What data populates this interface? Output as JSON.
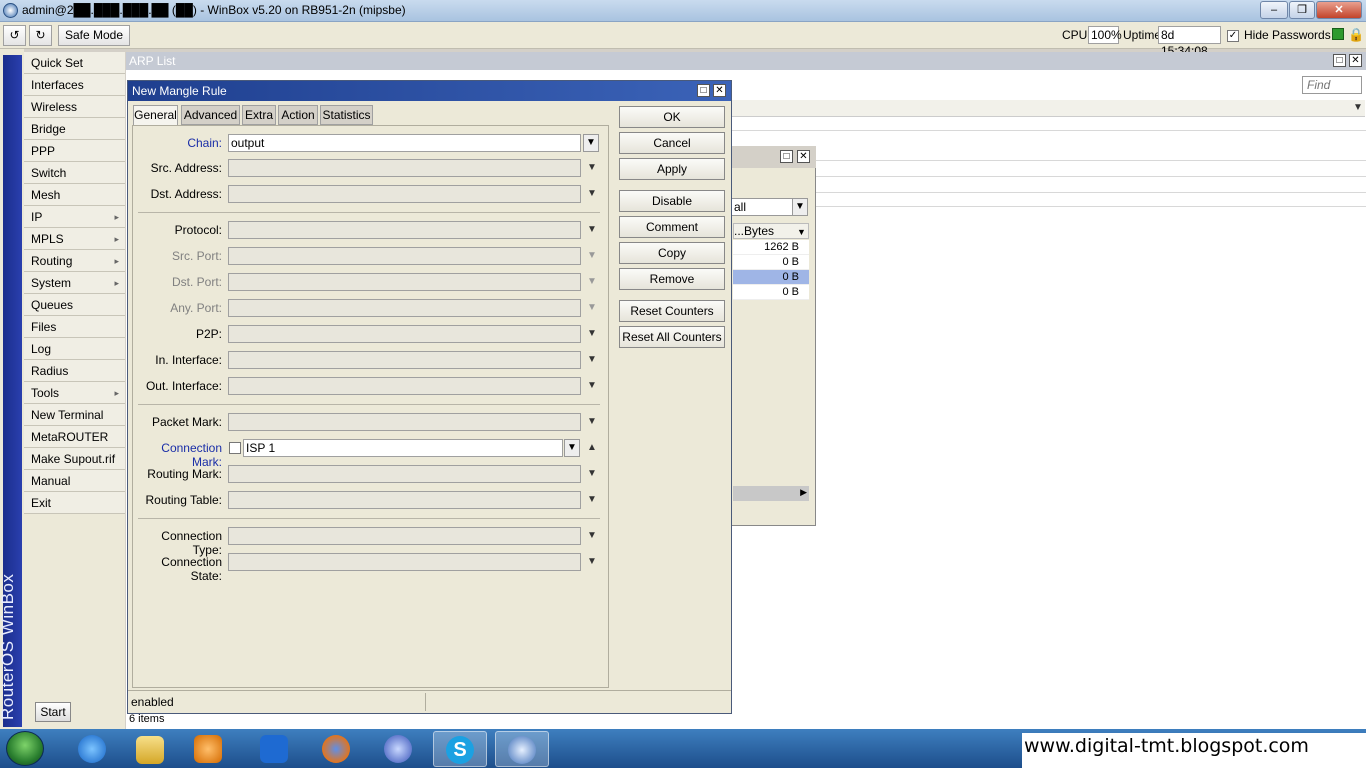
{
  "window": {
    "title": "admin@2██.███.███.██ (██) - WinBox v5.20 on RB951-2n (mipsbe)"
  },
  "toolbar": {
    "undo_icon": "undo-icon",
    "redo_icon": "redo-icon",
    "safe_mode": "Safe Mode",
    "cpu_label": "CPU:",
    "cpu_value": "100%",
    "uptime_label": "Uptime:",
    "uptime_value": "8d 15:34:08",
    "hide_passwords": "Hide Passwords"
  },
  "brand": "RouterOS WinBox",
  "menu": [
    {
      "label": "Quick Set",
      "sub": false
    },
    {
      "label": "Interfaces",
      "sub": false
    },
    {
      "label": "Wireless",
      "sub": false
    },
    {
      "label": "Bridge",
      "sub": false
    },
    {
      "label": "PPP",
      "sub": false
    },
    {
      "label": "Switch",
      "sub": false
    },
    {
      "label": "Mesh",
      "sub": false
    },
    {
      "label": "IP",
      "sub": true
    },
    {
      "label": "MPLS",
      "sub": true
    },
    {
      "label": "Routing",
      "sub": true
    },
    {
      "label": "System",
      "sub": true
    },
    {
      "label": "Queues",
      "sub": false
    },
    {
      "label": "Files",
      "sub": false
    },
    {
      "label": "Log",
      "sub": false
    },
    {
      "label": "Radius",
      "sub": false
    },
    {
      "label": "Tools",
      "sub": true
    },
    {
      "label": "New Terminal",
      "sub": false
    },
    {
      "label": "MetaROUTER",
      "sub": false
    },
    {
      "label": "Make Supout.rif",
      "sub": false
    },
    {
      "label": "Manual",
      "sub": false
    },
    {
      "label": "Exit",
      "sub": false
    }
  ],
  "start_button": "Start",
  "arp": {
    "title": "ARP List",
    "find_placeholder": "Find",
    "items_count": "6 items"
  },
  "bgwin": {
    "filter": "all",
    "col_prefix": "...",
    "col_bytes": "Bytes",
    "rows": [
      "1262 B",
      "0 B",
      "0 B",
      "0 B"
    ]
  },
  "dialog": {
    "title": "New Mangle Rule",
    "tabs": [
      "General",
      "Advanced",
      "Extra",
      "Action",
      "Statistics"
    ],
    "fields": {
      "chain": {
        "label": "Chain:",
        "value": "output"
      },
      "src_address": {
        "label": "Src. Address:",
        "value": ""
      },
      "dst_address": {
        "label": "Dst. Address:",
        "value": ""
      },
      "protocol": {
        "label": "Protocol:",
        "value": ""
      },
      "src_port": {
        "label": "Src. Port:",
        "value": ""
      },
      "dst_port": {
        "label": "Dst. Port:",
        "value": ""
      },
      "any_port": {
        "label": "Any. Port:",
        "value": ""
      },
      "p2p": {
        "label": "P2P:",
        "value": ""
      },
      "in_interface": {
        "label": "In. Interface:",
        "value": ""
      },
      "out_interface": {
        "label": "Out. Interface:",
        "value": ""
      },
      "packet_mark": {
        "label": "Packet Mark:",
        "value": ""
      },
      "connection_mark": {
        "label": "Connection Mark:",
        "value": "ISP 1"
      },
      "routing_mark": {
        "label": "Routing Mark:",
        "value": ""
      },
      "routing_table": {
        "label": "Routing Table:",
        "value": ""
      },
      "connection_type": {
        "label": "Connection Type:",
        "value": ""
      },
      "connection_state": {
        "label": "Connection State:",
        "value": ""
      }
    },
    "buttons": [
      "OK",
      "Cancel",
      "Apply",
      "Disable",
      "Comment",
      "Copy",
      "Remove",
      "Reset Counters",
      "Reset All Counters"
    ],
    "status": "enabled"
  },
  "taskbar": {
    "apps": [
      "ie-icon",
      "explorer-icon",
      "media-player-icon",
      "maxthon-icon",
      "firefox-icon",
      "globe-icon",
      "skype-icon",
      "winbox-icon"
    ]
  },
  "watermark": "www.digital-tmt.blogspot.com",
  "colors": {
    "accent": "#1a2ea8",
    "dialog_title": "#1f3f8f",
    "selected_row": "#9fb5e6"
  }
}
